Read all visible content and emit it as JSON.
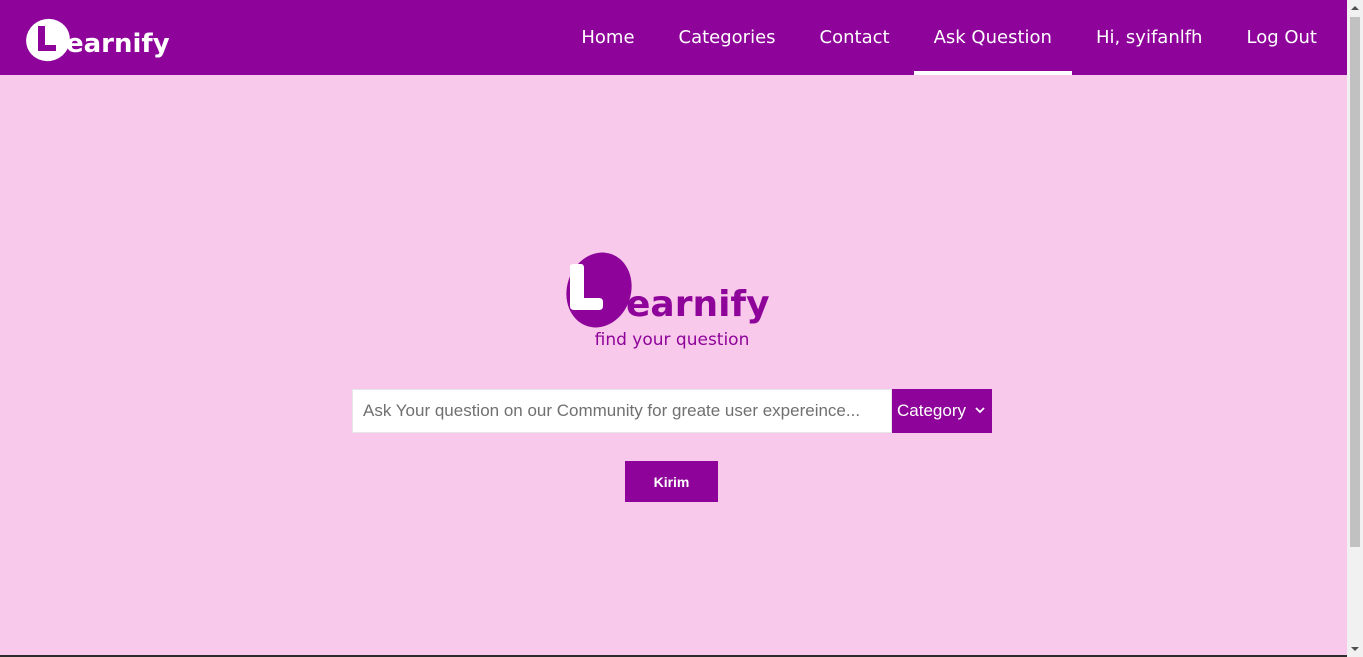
{
  "brand": {
    "name": "Learnify",
    "logo_letter": "L",
    "logo_rest": "earnify"
  },
  "nav": {
    "items": [
      {
        "label": "Home",
        "active": false
      },
      {
        "label": "Categories",
        "active": false
      },
      {
        "label": "Contact",
        "active": false
      },
      {
        "label": "Ask Question",
        "active": true
      },
      {
        "label": "Hi, syifanlfh",
        "active": false
      },
      {
        "label": "Log Out",
        "active": false
      }
    ]
  },
  "hero": {
    "logo_letter": "L",
    "logo_rest": "earnify",
    "tagline": "find your question"
  },
  "search": {
    "placeholder": "Ask Your question on our Community for greate user expereince...",
    "value": "",
    "category_label": "Category"
  },
  "submit": {
    "label": "Kirim"
  },
  "colors": {
    "primary": "#8e0399",
    "background": "#f8c9ea",
    "on_primary": "#ffffff"
  }
}
